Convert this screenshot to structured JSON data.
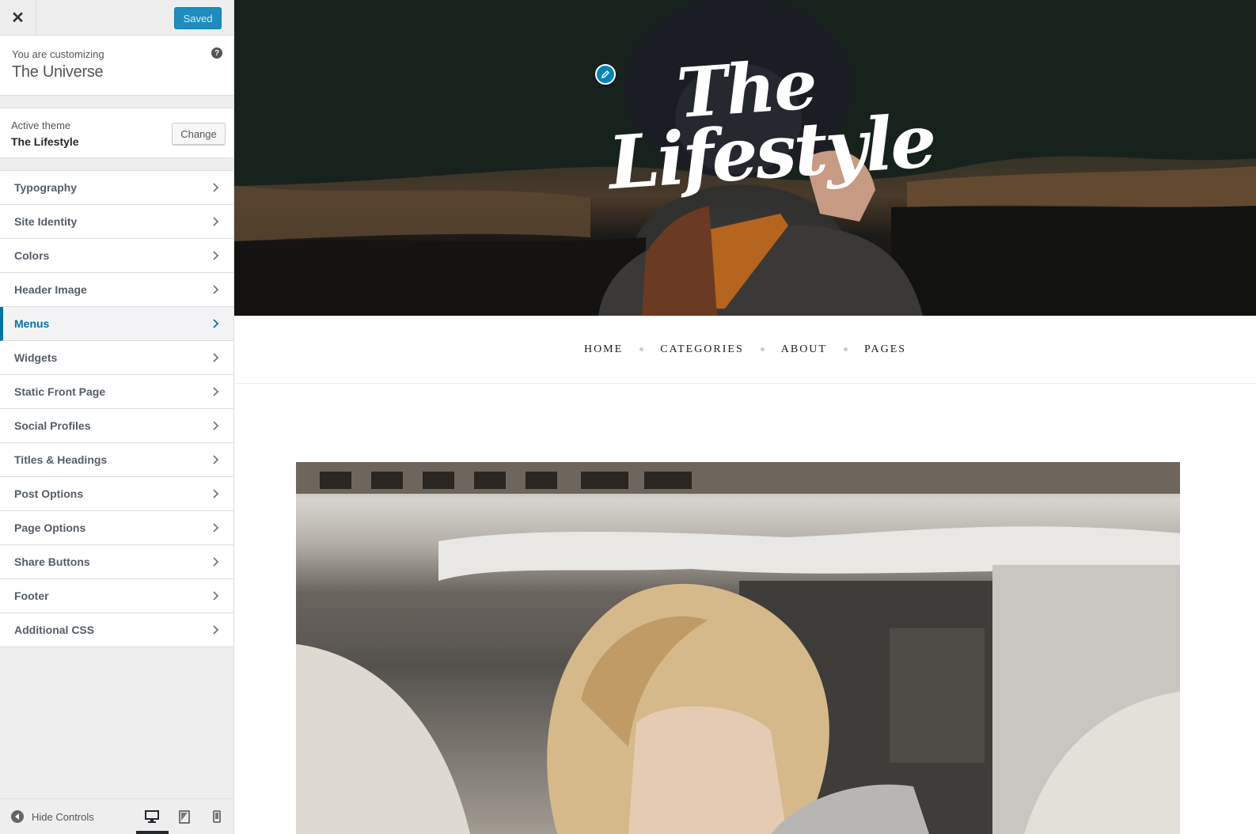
{
  "topbar": {
    "close_glyph": "✕",
    "saved_label": "Saved"
  },
  "info": {
    "customizing_label": "You are customizing",
    "site_title": "The Universe",
    "help_glyph": "?"
  },
  "theme": {
    "label": "Active theme",
    "name": "The Lifestyle",
    "change_label": "Change"
  },
  "panels": [
    {
      "label": "Typography"
    },
    {
      "label": "Site Identity"
    },
    {
      "label": "Colors"
    },
    {
      "label": "Header Image"
    },
    {
      "label": "Menus",
      "active": true
    },
    {
      "label": "Widgets"
    },
    {
      "label": "Static Front Page"
    },
    {
      "label": "Social Profiles"
    },
    {
      "label": "Titles & Headings"
    },
    {
      "label": "Post Options"
    },
    {
      "label": "Page Options"
    },
    {
      "label": "Share Buttons"
    },
    {
      "label": "Footer"
    },
    {
      "label": "Additional CSS"
    }
  ],
  "footer": {
    "hide_controls_label": "Hide Controls",
    "devices": [
      "desktop-icon",
      "tablet-icon",
      "mobile-icon"
    ],
    "selected_device": "desktop"
  },
  "preview": {
    "logo_line1": "The",
    "logo_line2": "Lifestyle",
    "nav": [
      "HOME",
      "CATEGORIES",
      "ABOUT",
      "PAGES"
    ]
  },
  "colors": {
    "accent": "#0073aa",
    "saved_button": "#1e8cbe",
    "sidebar_bg": "#eeeeee"
  }
}
